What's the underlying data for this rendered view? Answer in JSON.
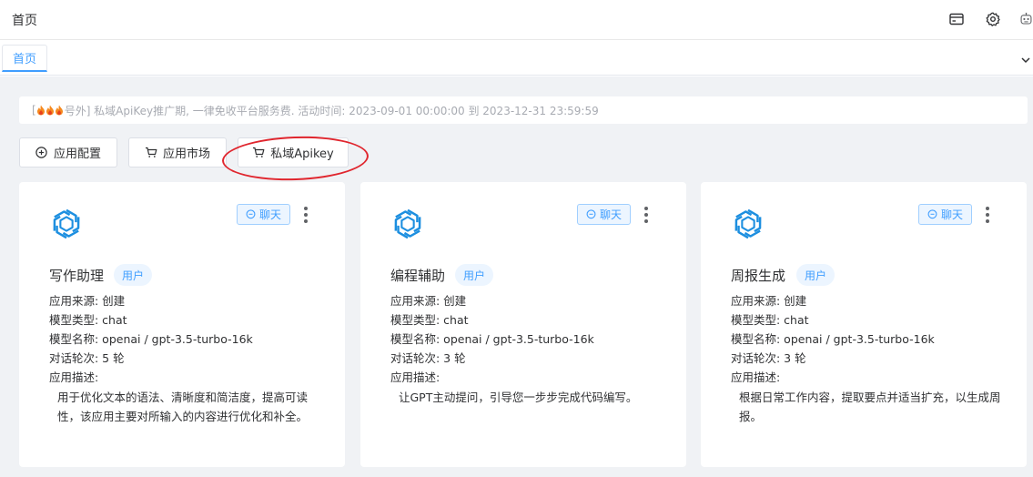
{
  "header": {
    "title": "首页",
    "icons": [
      "card-icon",
      "gear-icon",
      "robot-icon"
    ]
  },
  "tabs": [
    {
      "label": "首页",
      "active": true
    }
  ],
  "notice": {
    "flame_icon_count": 3,
    "text": "号外] 私域ApiKey推广期, 一律免收平台服务费. 活动时间: 2023-09-01 00:00:00 到 2023-12-31 23:59:59",
    "prefix": "["
  },
  "toolbar": {
    "app_config": "应用配置",
    "app_market": "应用市场",
    "private_apikey": "私域Apikey"
  },
  "cards": [
    {
      "name": "写作助理",
      "user_tag": "用户",
      "chat_tag": "聊天",
      "source": "应用来源: 创建",
      "model_type": "模型类型: chat",
      "model_name": "模型名称: openai / gpt-3.5-turbo-16k",
      "rounds": "对话轮次: 5 轮",
      "desc_label": "应用描述:",
      "desc": "用于优化文本的语法、清晰度和简洁度，提高可读性，该应用主要对所输入的内容进行优化和补全。"
    },
    {
      "name": "编程辅助",
      "user_tag": "用户",
      "chat_tag": "聊天",
      "source": "应用来源: 创建",
      "model_type": "模型类型: chat",
      "model_name": "模型名称: openai / gpt-3.5-turbo-16k",
      "rounds": "对话轮次: 3 轮",
      "desc_label": "应用描述:",
      "desc": "让GPT主动提问，引导您一步步完成代码编写。"
    },
    {
      "name": "周报生成",
      "user_tag": "用户",
      "chat_tag": "聊天",
      "source": "应用来源: 创建",
      "model_type": "模型类型: chat",
      "model_name": "模型名称: openai / gpt-3.5-turbo-16k",
      "rounds": "对话轮次: 3 轮",
      "desc_label": "应用描述:",
      "desc": "根据日常工作内容，提取要点并适当扩充，以生成周报。"
    }
  ],
  "colors": {
    "accent": "#409eff",
    "annotation": "#e0262e",
    "logo": "#1d8fe0"
  }
}
